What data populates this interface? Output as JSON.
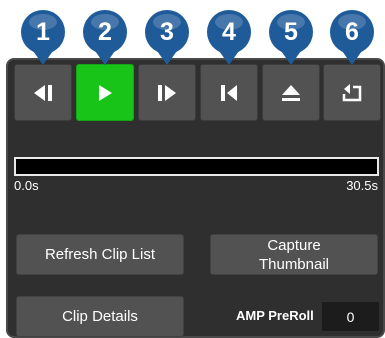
{
  "callouts": [
    "1",
    "2",
    "3",
    "4",
    "5",
    "6"
  ],
  "transport": [
    {
      "name": "step-back-button",
      "icon": "step-back-icon"
    },
    {
      "name": "play-button",
      "icon": "play-icon",
      "active": true
    },
    {
      "name": "step-forward-button",
      "icon": "step-forward-icon"
    },
    {
      "name": "go-to-start-button",
      "icon": "go-to-start-icon"
    },
    {
      "name": "eject-button",
      "icon": "eject-icon"
    },
    {
      "name": "return-button",
      "icon": "return-icon"
    }
  ],
  "timeline": {
    "start_label": "0.0s",
    "end_label": "30.5s",
    "position": 0
  },
  "buttons": {
    "refresh_clip_list": "Refresh Clip List",
    "capture_thumbnail": "Capture Thumbnail",
    "clip_details": "Clip Details"
  },
  "amp_preroll": {
    "label": "AMP PreRoll",
    "value": "0"
  },
  "colors": {
    "callout": "#1f5a99",
    "active": "#17c417",
    "panel": "#2f2f2f",
    "button": "#525252"
  }
}
